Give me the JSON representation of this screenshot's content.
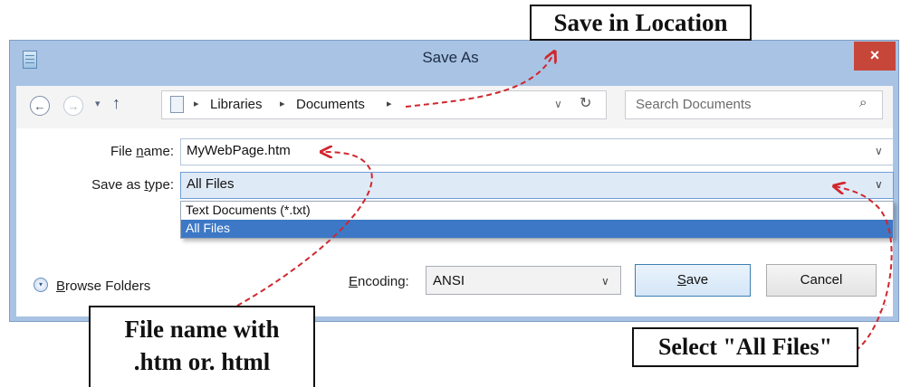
{
  "window": {
    "title": "Save As",
    "close_glyph": "×"
  },
  "nav": {
    "back_glyph": "←",
    "forward_glyph": "→",
    "recent_glyph": "▾",
    "up_glyph": "↑",
    "breadcrumb": [
      "Libraries",
      "Documents"
    ],
    "separator": "▸",
    "dropdown_glyph": "∨",
    "refresh_glyph": "↻",
    "search_placeholder": "Search Documents",
    "search_glyph": "⌕"
  },
  "form": {
    "file_name": {
      "label_pre": "File ",
      "label_ul": "n",
      "label_post": "ame:",
      "value": "MyWebPage.htm"
    },
    "save_type": {
      "label_pre": "Save as ",
      "label_ul": "t",
      "label_post": "ype:",
      "value": "All Files",
      "options": [
        "Text Documents (*.txt)",
        "All Files"
      ],
      "selected_index": 1
    },
    "dropdown_glyph": "∨"
  },
  "footer": {
    "browse_label_ul": "B",
    "browse_label_rest": "rowse Folders",
    "browse_glyph": "▾",
    "encoding": {
      "label_ul": "E",
      "label_rest": "ncoding:",
      "value": "ANSI"
    },
    "save_ul": "S",
    "save_rest": "ave",
    "cancel": "Cancel",
    "grip_glyph": "⋰"
  },
  "callouts": {
    "save_location": "Save in Location",
    "file_name_line1": "File name with",
    "file_name_line2": ".htm or. html",
    "all_files": "Select \"All Files\""
  },
  "colors": {
    "accent": "#3c78c6",
    "close": "#c7463a",
    "arrow": "#d0272e",
    "frame": "#a9c3e4"
  }
}
